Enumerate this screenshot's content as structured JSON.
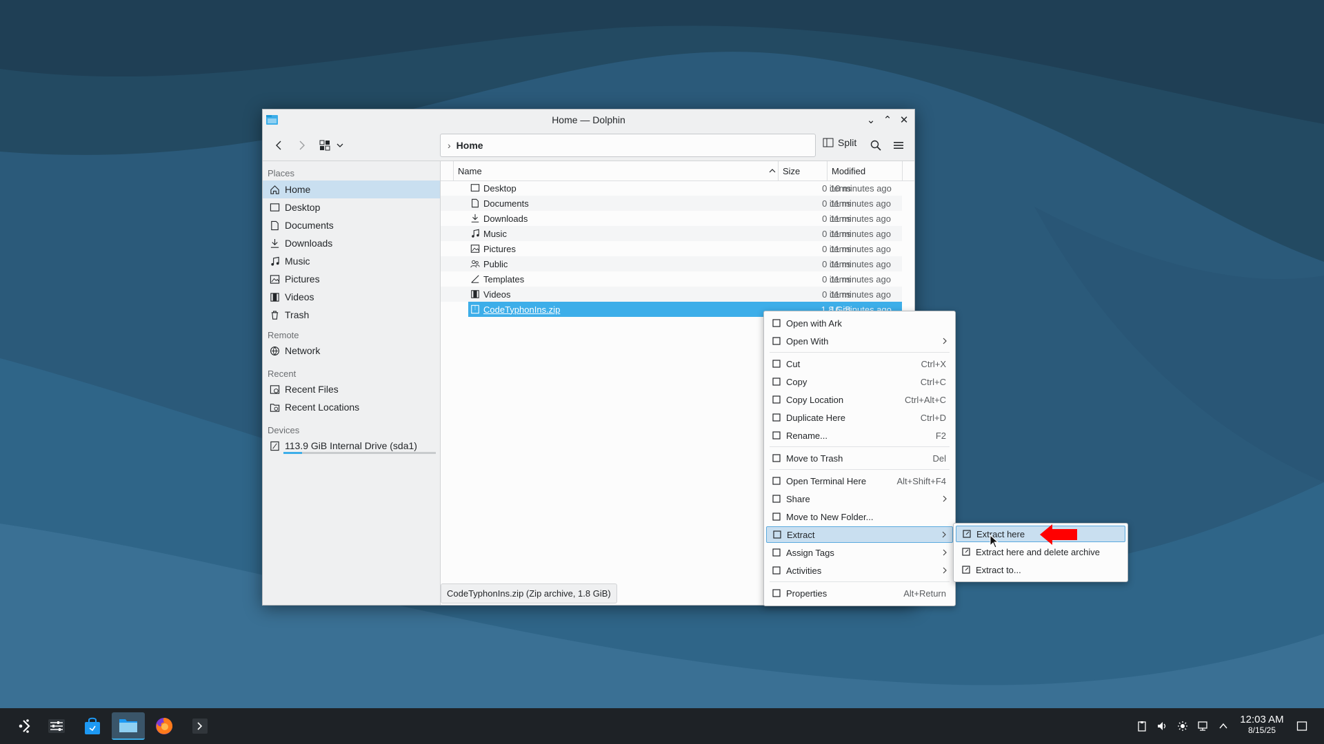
{
  "window": {
    "title": "Home — Dolphin",
    "controls": [
      "minimize",
      "maximize",
      "close"
    ]
  },
  "toolbar": {
    "breadcrumb": "Home",
    "split_label": "Split"
  },
  "sidebar": {
    "sections": {
      "places": "Places",
      "remote": "Remote",
      "recent": "Recent",
      "devices": "Devices"
    },
    "places": [
      {
        "label": "Home",
        "icon": "home-icon",
        "selected": true
      },
      {
        "label": "Desktop",
        "icon": "desktop-icon"
      },
      {
        "label": "Documents",
        "icon": "documents-icon"
      },
      {
        "label": "Downloads",
        "icon": "downloads-icon"
      },
      {
        "label": "Music",
        "icon": "music-icon"
      },
      {
        "label": "Pictures",
        "icon": "pictures-icon"
      },
      {
        "label": "Videos",
        "icon": "videos-icon"
      },
      {
        "label": "Trash",
        "icon": "trash-icon"
      }
    ],
    "remote": [
      {
        "label": "Network",
        "icon": "network-icon"
      }
    ],
    "recent": [
      {
        "label": "Recent Files",
        "icon": "recent-files-icon"
      },
      {
        "label": "Recent Locations",
        "icon": "recent-locations-icon"
      }
    ],
    "devices": [
      {
        "label": "113.9 GiB Internal Drive (sda1)",
        "icon": "drive-icon",
        "usage_fraction": 0.12
      }
    ]
  },
  "columns": {
    "name": "Name",
    "size": "Size",
    "modified": "Modified"
  },
  "files": [
    {
      "name": "Desktop",
      "size": "0 items",
      "modified": "10 minutes ago",
      "icon": "desktop-icon"
    },
    {
      "name": "Documents",
      "size": "0 items",
      "modified": "11 minutes ago",
      "icon": "documents-icon"
    },
    {
      "name": "Downloads",
      "size": "0 items",
      "modified": "11 minutes ago",
      "icon": "downloads-icon"
    },
    {
      "name": "Music",
      "size": "0 items",
      "modified": "11 minutes ago",
      "icon": "music-icon"
    },
    {
      "name": "Pictures",
      "size": "0 items",
      "modified": "11 minutes ago",
      "icon": "pictures-icon"
    },
    {
      "name": "Public",
      "size": "0 items",
      "modified": "11 minutes ago",
      "icon": "public-icon"
    },
    {
      "name": "Templates",
      "size": "0 items",
      "modified": "11 minutes ago",
      "icon": "templates-icon"
    },
    {
      "name": "Videos",
      "size": "0 items",
      "modified": "11 minutes ago",
      "icon": "videos-icon"
    },
    {
      "name": "CodeTyphonIns.zip",
      "size": "1.8 GiB",
      "modified": "16 minutes ago",
      "icon": "zip-icon",
      "selected": true
    }
  ],
  "status": "CodeTyphonIns.zip (Zip archive, 1.8 GiB)",
  "context_menu": [
    {
      "label": "Open with Ark",
      "icon": "ark-icon"
    },
    {
      "label": "Open With",
      "icon": "open-with-icon",
      "submenu": true
    },
    {
      "sep": true
    },
    {
      "label": "Cut",
      "shortcut": "Ctrl+X",
      "icon": "cut-icon"
    },
    {
      "label": "Copy",
      "shortcut": "Ctrl+C",
      "icon": "copy-icon"
    },
    {
      "label": "Copy Location",
      "shortcut": "Ctrl+Alt+C",
      "icon": "copy-location-icon"
    },
    {
      "label": "Duplicate Here",
      "shortcut": "Ctrl+D",
      "icon": "duplicate-icon"
    },
    {
      "label": "Rename...",
      "shortcut": "F2",
      "icon": "rename-icon"
    },
    {
      "sep": true
    },
    {
      "label": "Move to Trash",
      "shortcut": "Del",
      "icon": "trash-icon"
    },
    {
      "sep": true
    },
    {
      "label": "Open Terminal Here",
      "shortcut": "Alt+Shift+F4",
      "icon": "terminal-icon"
    },
    {
      "label": "Share",
      "icon": "share-icon",
      "submenu": true
    },
    {
      "label": "Move to New Folder...",
      "icon": "new-folder-icon"
    },
    {
      "label": "Extract",
      "icon": "extract-icon",
      "submenu": true,
      "highlighted": true
    },
    {
      "label": "Assign Tags",
      "icon": "tag-icon",
      "submenu": true
    },
    {
      "label": "Activities",
      "icon": "activities-icon",
      "submenu": true
    },
    {
      "sep": true
    },
    {
      "label": "Properties",
      "shortcut": "Alt+Return",
      "icon": "properties-icon"
    }
  ],
  "extract_submenu": [
    {
      "label": "Extract here",
      "highlighted": true
    },
    {
      "label": "Extract here and delete archive"
    },
    {
      "label": "Extract to..."
    }
  ],
  "taskbar": {
    "time": "12:03 AM",
    "date": "8/15/25"
  },
  "colors": {
    "accent": "#3daee9",
    "highlight": "#c9dff0",
    "annotation_arrow": "#ff0000"
  }
}
